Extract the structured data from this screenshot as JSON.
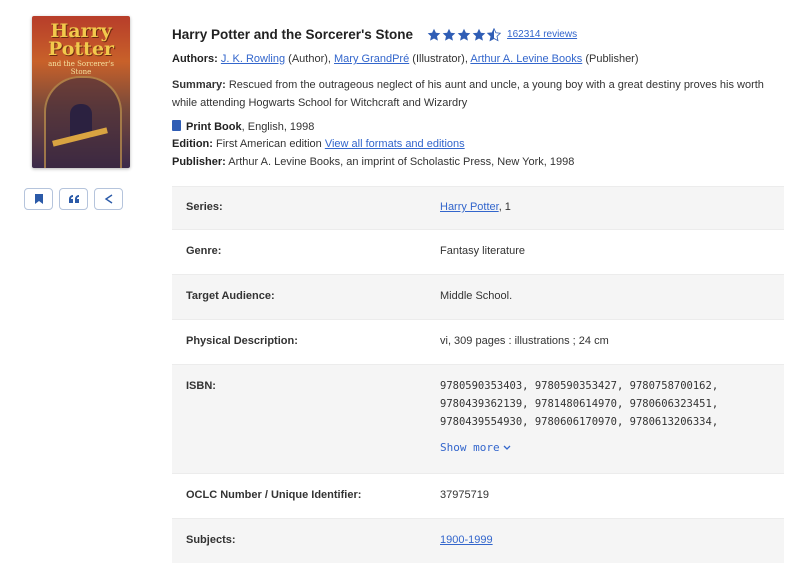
{
  "cover": {
    "title": "Harry Potter",
    "subtitle": "and the Sorcerer's Stone"
  },
  "actions": [
    {
      "name": "bookmark-button",
      "icon": "bookmark-icon"
    },
    {
      "name": "cite-button",
      "icon": "quote-icon"
    },
    {
      "name": "share-button",
      "icon": "share-icon"
    }
  ],
  "book": {
    "title": "Harry Potter and the Sorcerer's Stone",
    "rating": 4.5,
    "reviews": "162314 reviews",
    "authors_label": "Authors:",
    "author1": "J. K. Rowling",
    "author1_role": "(Author),",
    "author2": "Mary GrandPré",
    "author2_role": "(Illustrator),",
    "author3": "Arthur A. Levine Books",
    "author3_role": "(Publisher)",
    "summary_label": "Summary:",
    "summary": "Rescued from the outrageous neglect of his aunt and uncle, a young boy with a great destiny proves his worth while attending Hogwarts School for Witchcraft and Wizardry",
    "format_label": "Print Book",
    "format_rest": ", English, 1998",
    "edition_label": "Edition:",
    "edition": "First American edition",
    "edition_link": "View all formats and editions",
    "publisher_label": "Publisher:",
    "publisher": "Arthur A. Levine Books, an imprint of Scholastic Press, New York, 1998"
  },
  "details": {
    "series_label": "Series:",
    "series_link": "Harry Potter",
    "series_num": ", 1",
    "genre_label": "Genre:",
    "genre": "Fantasy literature",
    "audience_label": "Target Audience:",
    "audience": "Middle School.",
    "physical_label": "Physical Description:",
    "physical": "vi, 309 pages : illustrations ; 24 cm",
    "isbn_label": "ISBN:",
    "isbn_line1": "9780590353403, 9780590353427, 9780758700162,",
    "isbn_line2": "9780439362139, 9781480614970, 9780606323451,",
    "isbn_line3": "9780439554930, 9780606170970, 9780613206334,",
    "show_more": "Show more",
    "oclc_label": "OCLC Number / Unique Identifier:",
    "oclc": "37975719",
    "subjects_label": "Subjects:",
    "subjects_link": "1900-1999"
  },
  "colors": {
    "link": "#3366cc",
    "star": "#2f5db5",
    "alt_row": "#f5f5f5"
  }
}
